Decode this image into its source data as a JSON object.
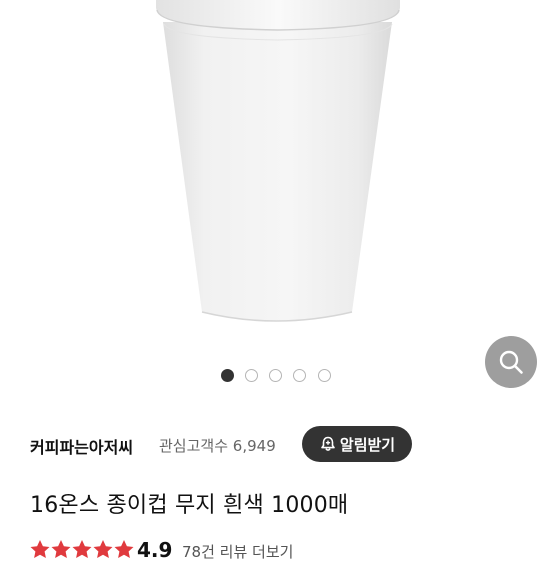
{
  "gallery": {
    "slide_count": 5,
    "active_index": 0,
    "zoom_icon": "magnifier-icon"
  },
  "seller": {
    "name": "커피파는아저씨",
    "interest_label": "관심고객수",
    "interest_count": "6,949",
    "alert_label": "알림받기",
    "alert_icon": "bell-plus-icon"
  },
  "product": {
    "title": "16온스 종이컵 무지 흰색 1000매"
  },
  "rating": {
    "value": "4.9",
    "stars": 5,
    "star_color": "#e03a3e",
    "review_link": "78건 리뷰 더보기"
  },
  "colors": {
    "alert_button_bg": "#333333",
    "zoom_button_bg": "#9e9e9e",
    "active_dot": "#333333"
  }
}
